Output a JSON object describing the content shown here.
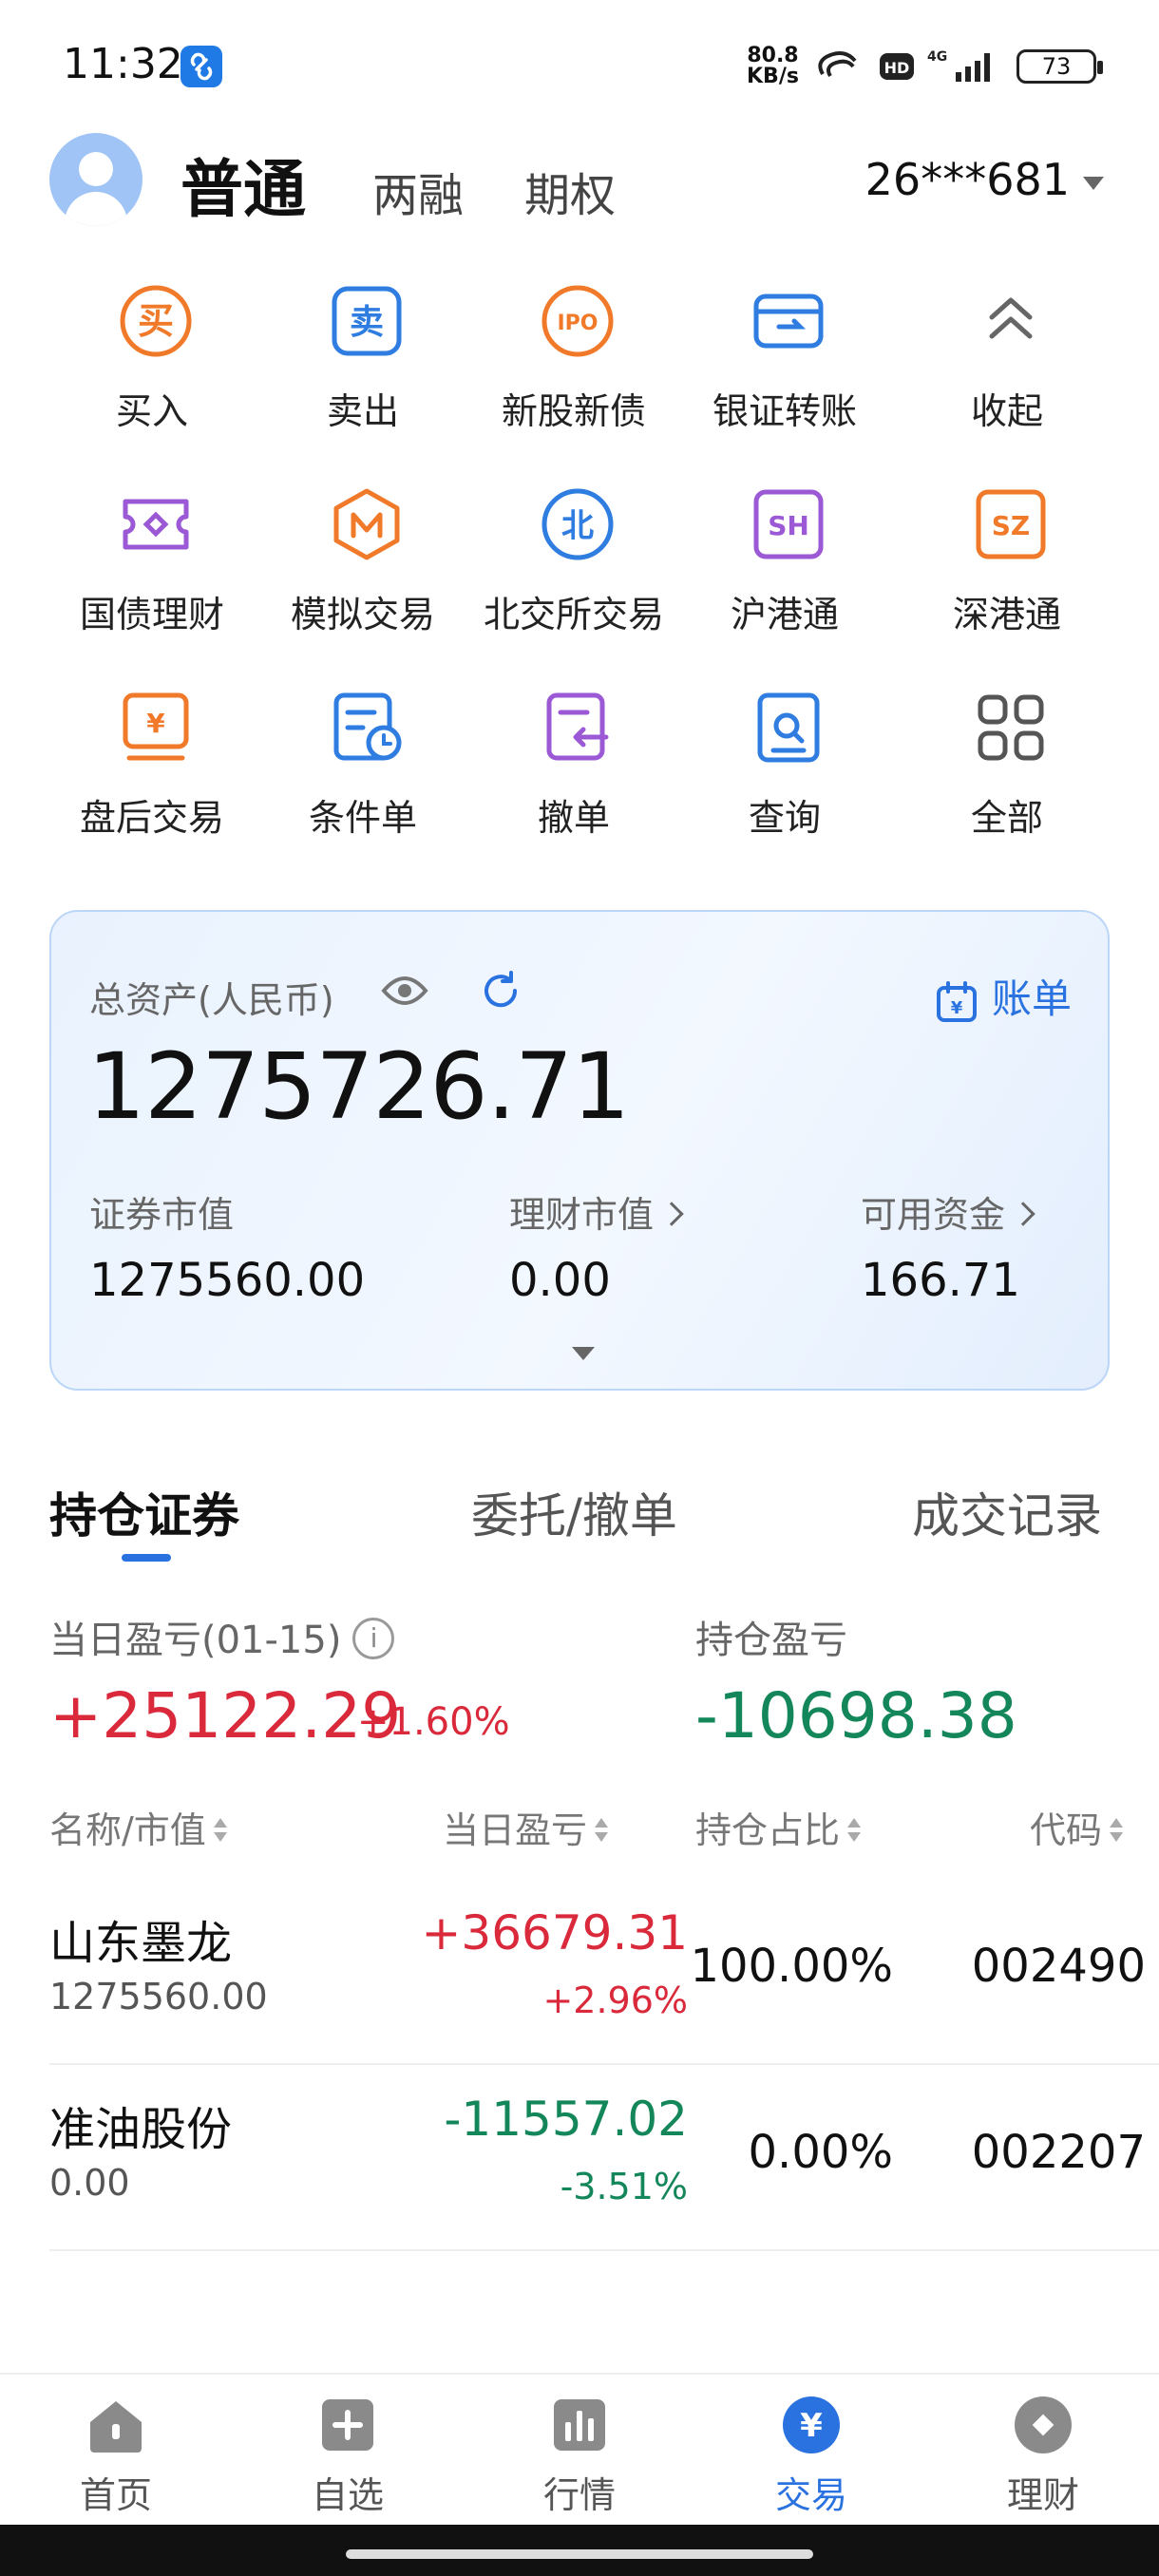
{
  "status_bar": {
    "time": "11:32",
    "speed_value": "80.8",
    "speed_unit": "KB/s",
    "battery": "73",
    "icons": [
      "link-icon",
      "hotspot-icon",
      "hd-icon",
      "signal-4g-icon",
      "battery-icon"
    ]
  },
  "header": {
    "main_tab": "普通",
    "tabs": [
      "两融",
      "期权"
    ],
    "account": "26***681"
  },
  "menu": [
    {
      "label": "买入",
      "icon": "buy-icon",
      "color": "#f07a2a"
    },
    {
      "label": "卖出",
      "icon": "sell-icon",
      "color": "#2f7de1"
    },
    {
      "label": "新股新债",
      "icon": "ipo-icon",
      "color": "#f07a2a"
    },
    {
      "label": "银证转账",
      "icon": "bank-transfer-icon",
      "color": "#2f7de1"
    },
    {
      "label": "收起",
      "icon": "collapse-icon",
      "color": "#666666"
    },
    {
      "label": "国债理财",
      "icon": "treasury-icon",
      "color": "#9b59d6"
    },
    {
      "label": "模拟交易",
      "icon": "simulated-trade-icon",
      "color": "#f07a2a"
    },
    {
      "label": "北交所交易",
      "icon": "bse-icon",
      "color": "#2f7de1"
    },
    {
      "label": "沪港通",
      "icon": "sh-connect-icon",
      "color": "#9b59d6"
    },
    {
      "label": "深港通",
      "icon": "sz-connect-icon",
      "color": "#f07a2a"
    },
    {
      "label": "盘后交易",
      "icon": "after-hours-icon",
      "color": "#f07a2a"
    },
    {
      "label": "条件单",
      "icon": "conditional-order-icon",
      "color": "#2f7de1"
    },
    {
      "label": "撤单",
      "icon": "cancel-order-icon",
      "color": "#9b59d6"
    },
    {
      "label": "查询",
      "icon": "query-icon",
      "color": "#2f7de1"
    },
    {
      "label": "全部",
      "icon": "all-apps-icon",
      "color": "#555555"
    }
  ],
  "assets": {
    "total_label": "总资产(人民币)",
    "total_value": "1275726.71",
    "bill_label": "账单",
    "securities_label": "证券市值",
    "securities_value": "1275560.00",
    "wealth_label": "理财市值",
    "wealth_value": "0.00",
    "cash_label": "可用资金",
    "cash_value": "166.71"
  },
  "position_tabs": [
    "持仓证券",
    "委托/撤单",
    "成交记录"
  ],
  "pnl": {
    "day_label": "当日盈亏(01-15)",
    "day_value": "+25122.29",
    "day_pct": "+1.60%",
    "hold_label": "持仓盈亏",
    "hold_value": "-10698.38"
  },
  "table": {
    "headers": [
      "名称/市值",
      "当日盈亏",
      "持仓占比",
      "代码"
    ],
    "rows": [
      {
        "name": "山东墨龙",
        "market_value": "1275560.00",
        "day_pnl": "+36679.31",
        "day_pct": "+2.96%",
        "ratio": "100.00%",
        "code": "002490",
        "direction": "up"
      },
      {
        "name": "准油股份",
        "market_value": "0.00",
        "day_pnl": "-11557.02",
        "day_pct": "-3.51%",
        "ratio": "0.00%",
        "code": "002207",
        "direction": "down"
      }
    ]
  },
  "bottom_nav": [
    {
      "label": "首页",
      "icon": "home-icon",
      "active": false
    },
    {
      "label": "自选",
      "icon": "watchlist-icon",
      "active": false
    },
    {
      "label": "行情",
      "icon": "market-icon",
      "active": false
    },
    {
      "label": "交易",
      "icon": "trade-icon",
      "active": true
    },
    {
      "label": "理财",
      "icon": "wealth-icon",
      "active": false
    }
  ],
  "colors": {
    "accent": "#2a72e0",
    "rise": "#d9293b",
    "fall": "#13865a"
  }
}
